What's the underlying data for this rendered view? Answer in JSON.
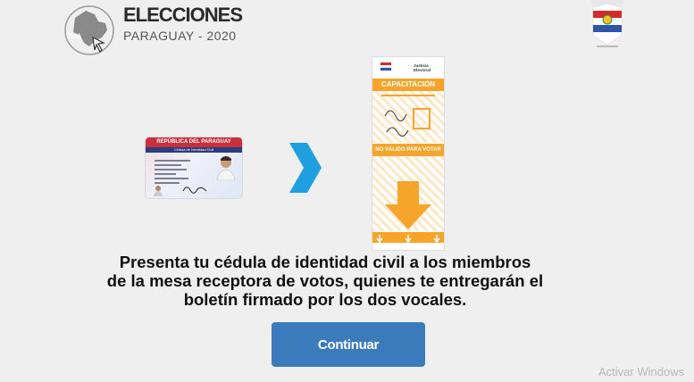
{
  "header": {
    "title": "ELECCIONES",
    "subtitle": "PARAGUAY - 2020",
    "badge": "Votá"
  },
  "id_card": {
    "header": "REPÚBLICA DEL PARAGUAY",
    "subheader": "Cédula de Identidad Civil"
  },
  "arrow": {
    "color": "#1f9fe0"
  },
  "ballot": {
    "brand": "Justicia Electoral",
    "band_label": "CAPACITACIÓN",
    "invalid_label": "NO VÁLIDO PARA VOTAR",
    "accent_color": "#f7a42b"
  },
  "instruction": "Presenta tu cédula de identidad civil a los miembros\nde la mesa receptora de votos, quienes te entregarán el\nboletín firmado por los dos vocales.",
  "continue_button": {
    "label": "Continuar",
    "color": "#3b7abb"
  },
  "os_watermark": "Activar Windows"
}
